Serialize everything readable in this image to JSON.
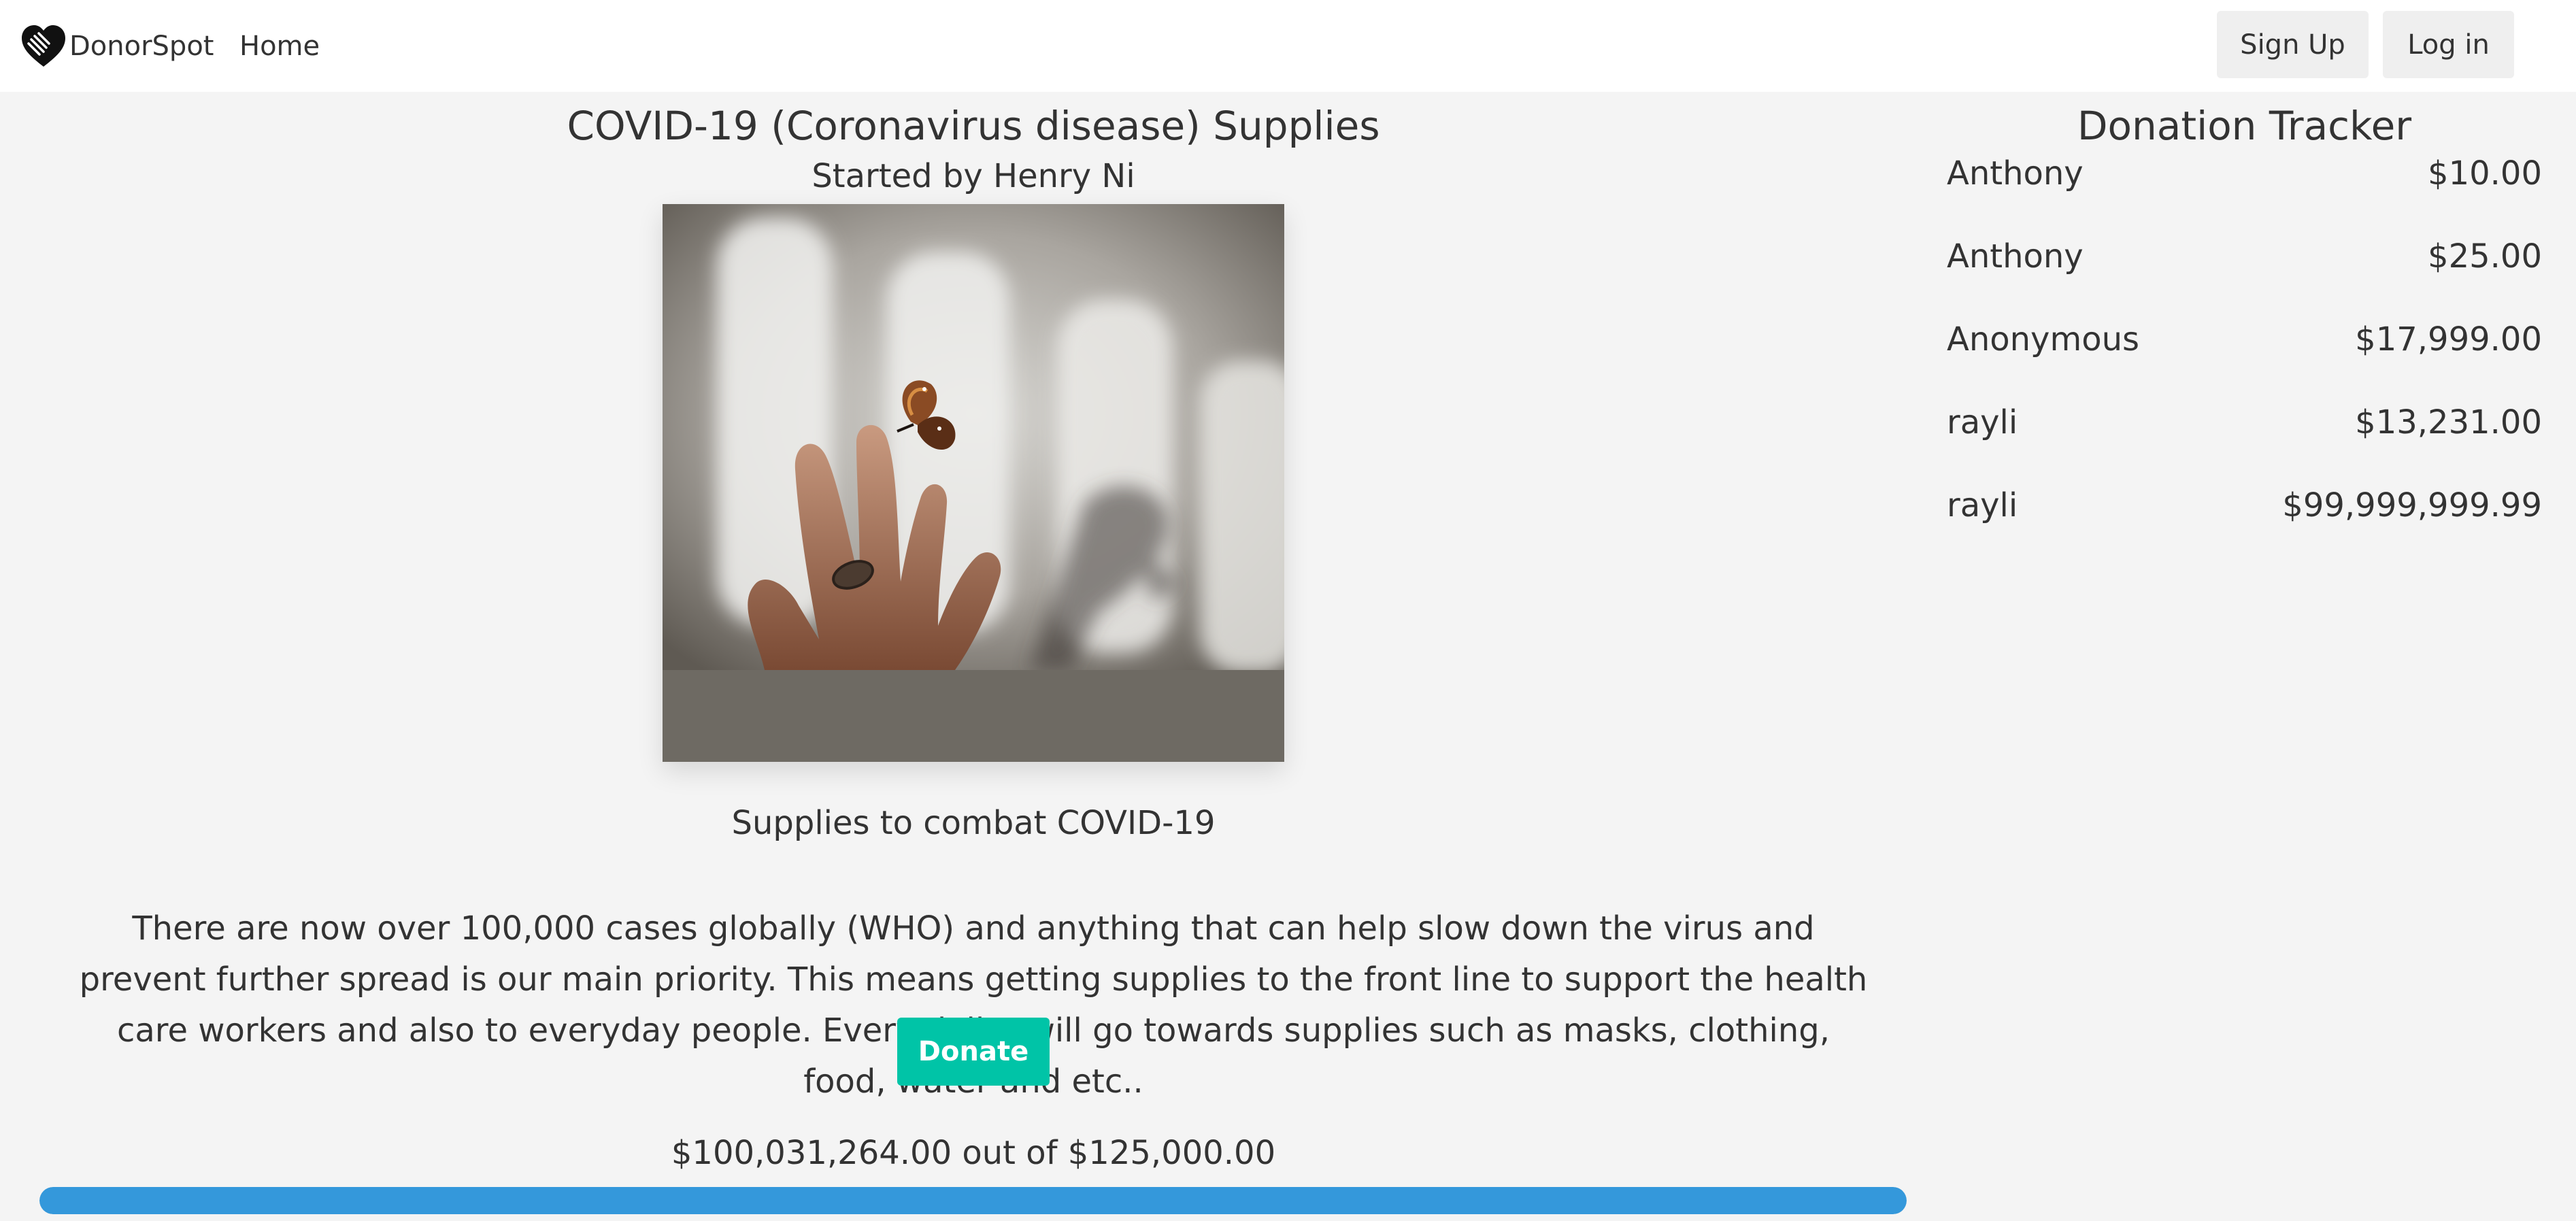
{
  "navbar": {
    "brand_name": "DonorSpot",
    "brand_icon": "hands-heart-icon",
    "home_label": "Home",
    "signup_label": "Sign Up",
    "login_label": "Log in"
  },
  "campaign": {
    "title": "COVID-19 (Coronavirus disease) Supplies",
    "started_by": "Started by Henry Ni",
    "short_description": "Supplies to combat COVID-19",
    "description": "There are now over 100,000 cases globally (WHO) and anything that can help slow down the virus and prevent further spread is our main priority. This means getting supplies to the front line to support the health care workers and also to everyday people. Every dollar will go towards supplies such as masks, clothing, food, water and etc..",
    "donate_label": "Donate",
    "progress_text": "$100,031,264.00 out of $125,000.00",
    "progress_fraction": 1.0
  },
  "tracker": {
    "title": "Donation Tracker",
    "donations": [
      {
        "name": "Anthony",
        "amount": "$10.00"
      },
      {
        "name": "Anthony",
        "amount": "$25.00"
      },
      {
        "name": "Anonymous",
        "amount": "$17,999.00"
      },
      {
        "name": "rayli",
        "amount": "$13,231.00"
      },
      {
        "name": "rayli",
        "amount": "$99,999,999.99"
      }
    ]
  },
  "colors": {
    "primary": "#00c4a7",
    "progress": "#3498db",
    "background": "#f4f4f4",
    "navbar": "#ffffff"
  }
}
